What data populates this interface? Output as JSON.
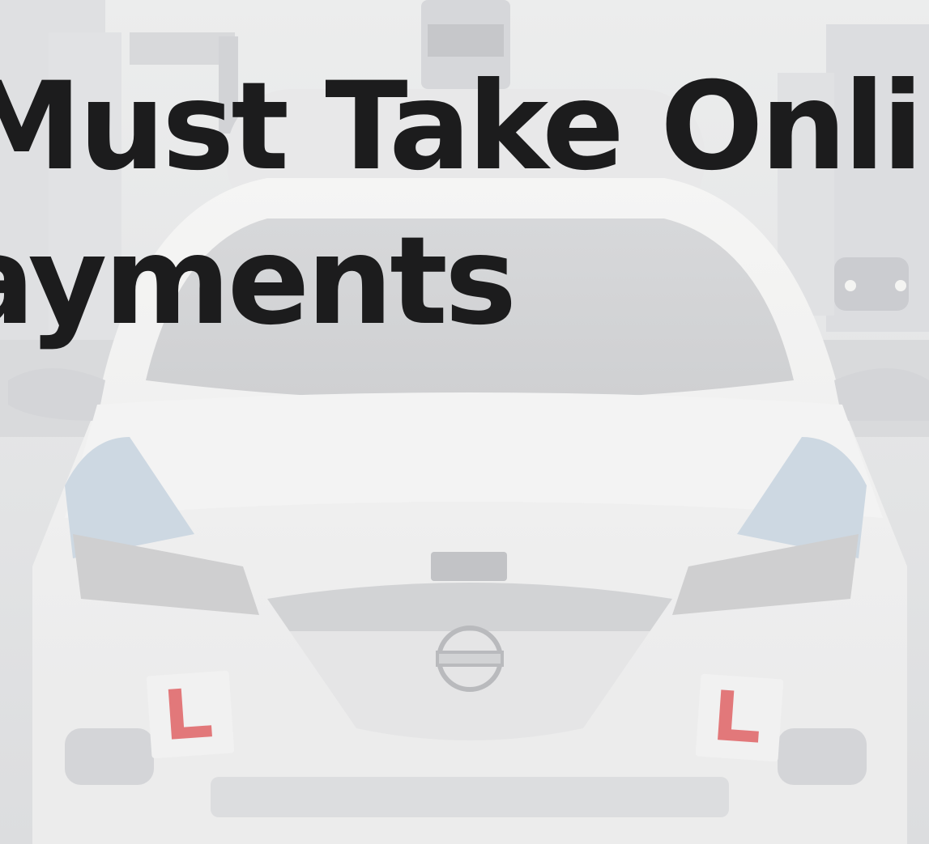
{
  "hero": {
    "heading_lines": [
      "Must Take Onli",
      "ayments"
    ],
    "plate_letter": "L",
    "colors": {
      "heading": "#1c1c1d",
      "wash": "#e6e7e8",
      "plate_letter": "#e2787a"
    },
    "icons": [
      "car-photo",
      "brand-logo-icon",
      "learner-plate-icon"
    ]
  }
}
